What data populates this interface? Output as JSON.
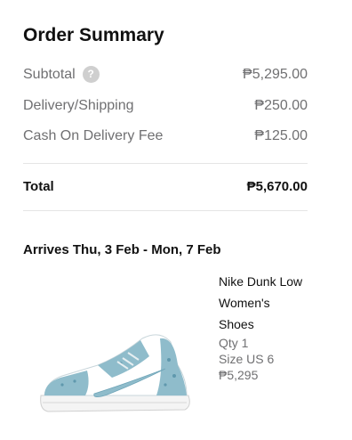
{
  "summary": {
    "title": "Order Summary",
    "subtotal_label": "Subtotal",
    "help_icon": "?",
    "subtotal_value": "₱5,295.00",
    "delivery_label": "Delivery/Shipping",
    "delivery_value": "₱250.00",
    "cod_label": "Cash On Delivery Fee",
    "cod_value": "₱125.00",
    "total_label": "Total",
    "total_value": "₱5,670.00"
  },
  "delivery": {
    "arrives": "Arrives Thu, 3 Feb - Mon, 7 Feb"
  },
  "product": {
    "name_line1": "Nike Dunk Low",
    "name_line2": "Women's",
    "name_line3": "Shoes",
    "qty": "Qty 1",
    "size": "Size US 6",
    "price": "₱5,295",
    "image_icon": "sneaker-image"
  },
  "colors": {
    "accent_blue": "#7fb3c3",
    "muted_text": "#707072"
  }
}
